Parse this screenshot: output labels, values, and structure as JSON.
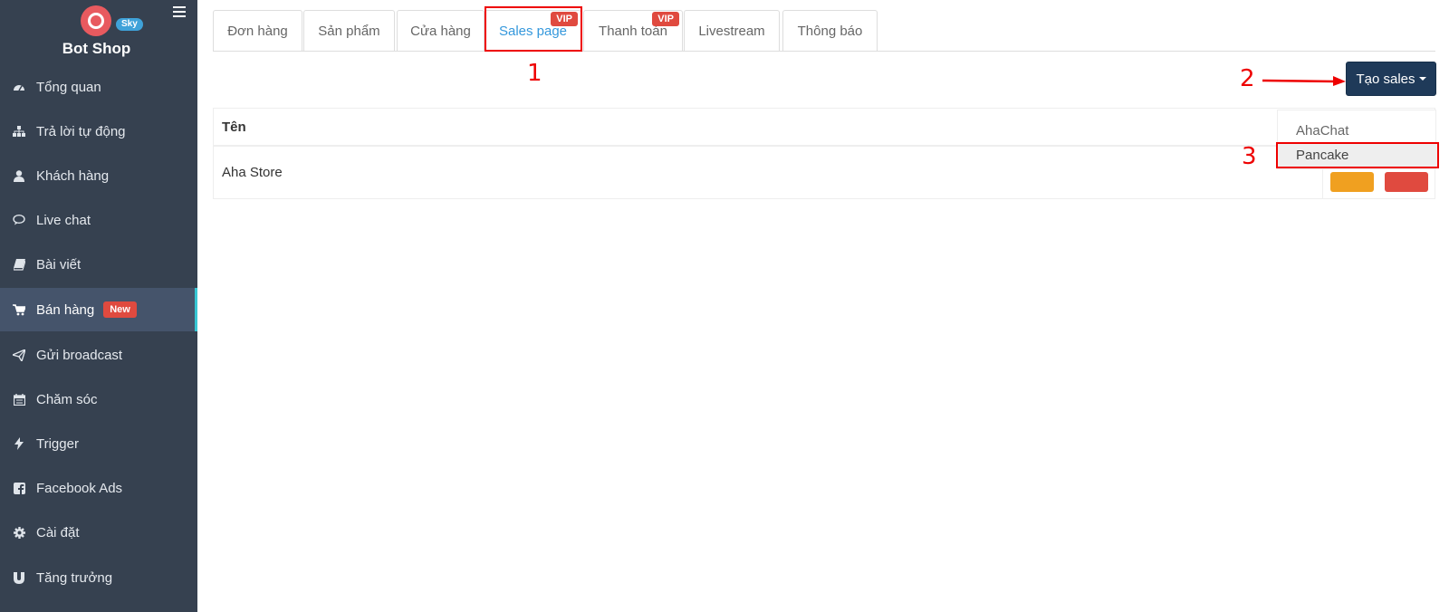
{
  "brand": {
    "name": "Bot Shop",
    "badge": "Sky"
  },
  "sidebar": {
    "items": [
      {
        "label": "Tổng quan",
        "icon": "dashboard-icon"
      },
      {
        "label": "Trả lời tự động",
        "icon": "sitemap-icon"
      },
      {
        "label": "Khách hàng",
        "icon": "user-icon"
      },
      {
        "label": "Live chat",
        "icon": "chat-icon"
      },
      {
        "label": "Bài viết",
        "icon": "book-icon"
      },
      {
        "label": "Bán hàng",
        "icon": "cart-icon",
        "badge": "New",
        "active": true
      },
      {
        "label": "Gửi broadcast",
        "icon": "paper-plane-icon"
      },
      {
        "label": "Chăm sóc",
        "icon": "calendar-icon"
      },
      {
        "label": "Trigger",
        "icon": "bolt-icon"
      },
      {
        "label": "Facebook Ads",
        "icon": "facebook-icon"
      },
      {
        "label": "Cài đặt",
        "icon": "gear-icon"
      },
      {
        "label": "Tăng trưởng",
        "icon": "magnet-icon"
      }
    ]
  },
  "tabs": [
    {
      "label": "Đơn hàng"
    },
    {
      "label": "Sản phẩm"
    },
    {
      "label": "Cửa hàng"
    },
    {
      "label": "Sales page",
      "badge": "VIP",
      "active": true
    },
    {
      "label": "Thanh toán",
      "badge": "VIP"
    },
    {
      "label": "Livestream"
    },
    {
      "label": "Thông báo"
    }
  ],
  "create_button": {
    "label": "Tạo sales"
  },
  "table": {
    "header": "Tên",
    "rows": [
      {
        "name": "Aha Store"
      }
    ]
  },
  "dropdown": {
    "items": [
      {
        "label": "AhaChat"
      },
      {
        "label": "Pancake"
      }
    ]
  },
  "annotations": {
    "one": "1",
    "two": "2",
    "three": "3"
  },
  "colors": {
    "sidebar": "#364150",
    "accent": "#3598dc",
    "badge": "#e04a3f",
    "button": "#1f3a59",
    "annotation": "#ff0000"
  }
}
